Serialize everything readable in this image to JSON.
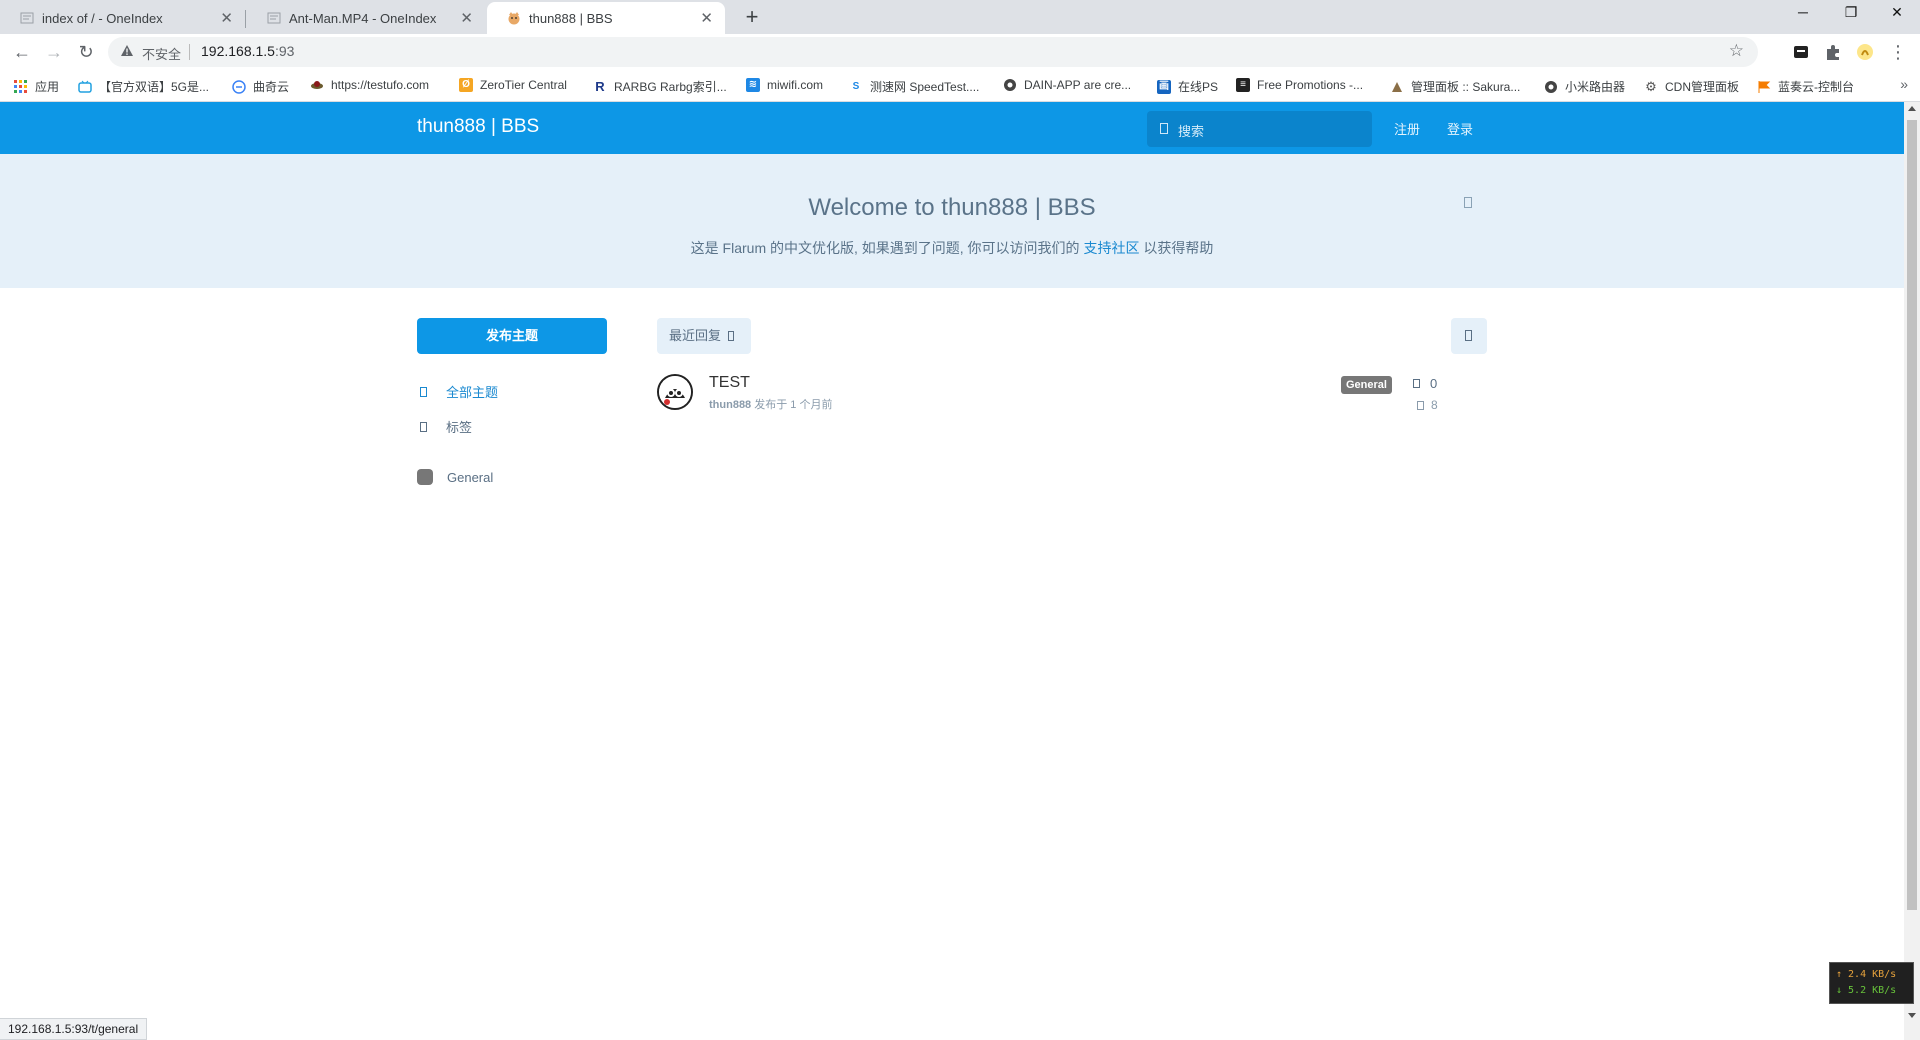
{
  "browser": {
    "tabs": [
      {
        "title": "index of / - OneIndex",
        "active": false
      },
      {
        "title": "Ant-Man.MP4 - OneIndex",
        "active": false
      },
      {
        "title": "thun888 | BBS",
        "active": true
      }
    ],
    "new_tab_label": "+",
    "window_controls": {
      "minimize": "─",
      "restore": "❐",
      "close": "✕"
    },
    "address": {
      "security_label": "不安全",
      "host": "192.168.1.5",
      "port": ":93"
    },
    "bookmarks": [
      {
        "label": "应用",
        "icon": "apps-grid-icon",
        "color": "#e84c3d"
      },
      {
        "label": "【官方双语】5G是...",
        "icon": "bilibili-icon",
        "color": "#20a0e0"
      },
      {
        "label": "曲奇云",
        "icon": "cookie-cloud-icon",
        "color": "#3b82f6"
      },
      {
        "label": "https://testufo.com",
        "icon": "ufo-icon",
        "color": "#6b5b2e"
      },
      {
        "label": "ZeroTier Central",
        "icon": "zerotier-icon",
        "color": "#f5a623"
      },
      {
        "label": "RARBG Rarbg索引...",
        "icon": "rarbg-icon",
        "color": "#1e3a8a"
      },
      {
        "label": "miwifi.com",
        "icon": "wifi-icon",
        "color": "#1e88e5"
      },
      {
        "label": "测速网 SpeedTest....",
        "icon": "speedtest-icon",
        "color": "#1e88e5"
      },
      {
        "label": "DAIN-APP are cre...",
        "icon": "globe-icon",
        "color": "#444444"
      },
      {
        "label": "在线PS",
        "icon": "photoshop-icon",
        "color": "#1565c0"
      },
      {
        "label": "Free Promotions -...",
        "icon": "document-icon",
        "color": "#222222"
      },
      {
        "label": "管理面板 :: Sakura...",
        "icon": "sakura-icon",
        "color": "#8b6f47"
      },
      {
        "label": "小米路由器",
        "icon": "globe-icon",
        "color": "#444444"
      },
      {
        "label": "CDN管理面板",
        "icon": "gear-icon",
        "color": "#555555"
      },
      {
        "label": "蓝奏云-控制台",
        "icon": "flag-icon",
        "color": "#f57c00"
      }
    ],
    "bookmarks_more": "»",
    "status_url": "192.168.1.5:93/t/general"
  },
  "forum": {
    "site_title": "thun888 | BBS",
    "search_placeholder": "搜索",
    "signup": "注册",
    "login": "登录",
    "hero_title": "Welcome to thun888 | BBS",
    "hero_text_before": "这是 Flarum 的中文优化版, 如果遇到了问题, 你可以访问我们的 ",
    "hero_link": "支持社区",
    "hero_text_after": " 以获得帮助",
    "compose_label": "发布主题",
    "nav": {
      "all": "全部主题",
      "tags": "标签",
      "tag_general": "General"
    },
    "sort_label": "最近回复",
    "discussions": [
      {
        "title": "TEST",
        "author": "thun888",
        "posted": "发布于 1 个月前",
        "tag": "General",
        "replies": "0",
        "views": "8"
      }
    ]
  },
  "netspeed": {
    "up": "↑ 2.4 KB/s",
    "down": "↓ 5.2 KB/s"
  },
  "colors": {
    "header": "#0d97e6",
    "hero_bg": "#e5f0f9",
    "link": "#1a89d0",
    "tag": "#777777"
  }
}
